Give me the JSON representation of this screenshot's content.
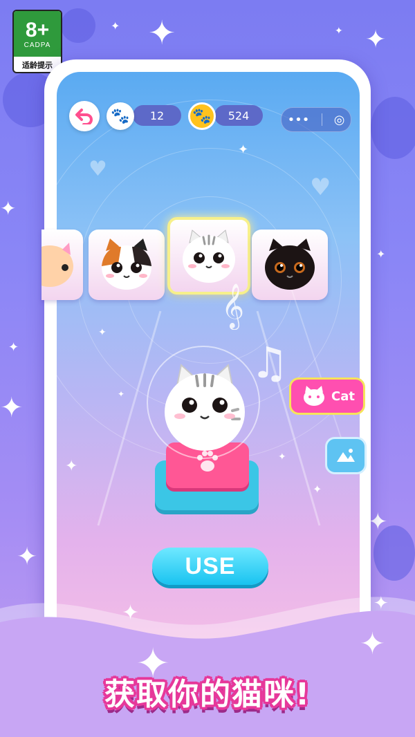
{
  "age_rating": {
    "number": "8+",
    "org": "CADPA",
    "tip": "适龄提示"
  },
  "top_bar": {
    "paw_count": "12",
    "coin_count": "524",
    "back_icon": "back-arrow-icon",
    "menu_dots": "•••",
    "target_icon": "◎"
  },
  "cats": [
    {
      "name": "pink-cat",
      "color": "#ffb3cf"
    },
    {
      "name": "calico-cat",
      "color": "#ffffff"
    },
    {
      "name": "white-tabby-cat",
      "color": "#ffffff",
      "selected": true
    },
    {
      "name": "black-cat",
      "color": "#1c1414"
    }
  ],
  "side_tabs": {
    "cat_label": "Cat",
    "bg_icon": "image-icon"
  },
  "use_label": "USE",
  "caption": "获取你的猫咪!",
  "colors": {
    "accent_pink": "#ff4fb0",
    "accent_cyan": "#19c3f0",
    "bg_purple": "#7c7cf2"
  }
}
